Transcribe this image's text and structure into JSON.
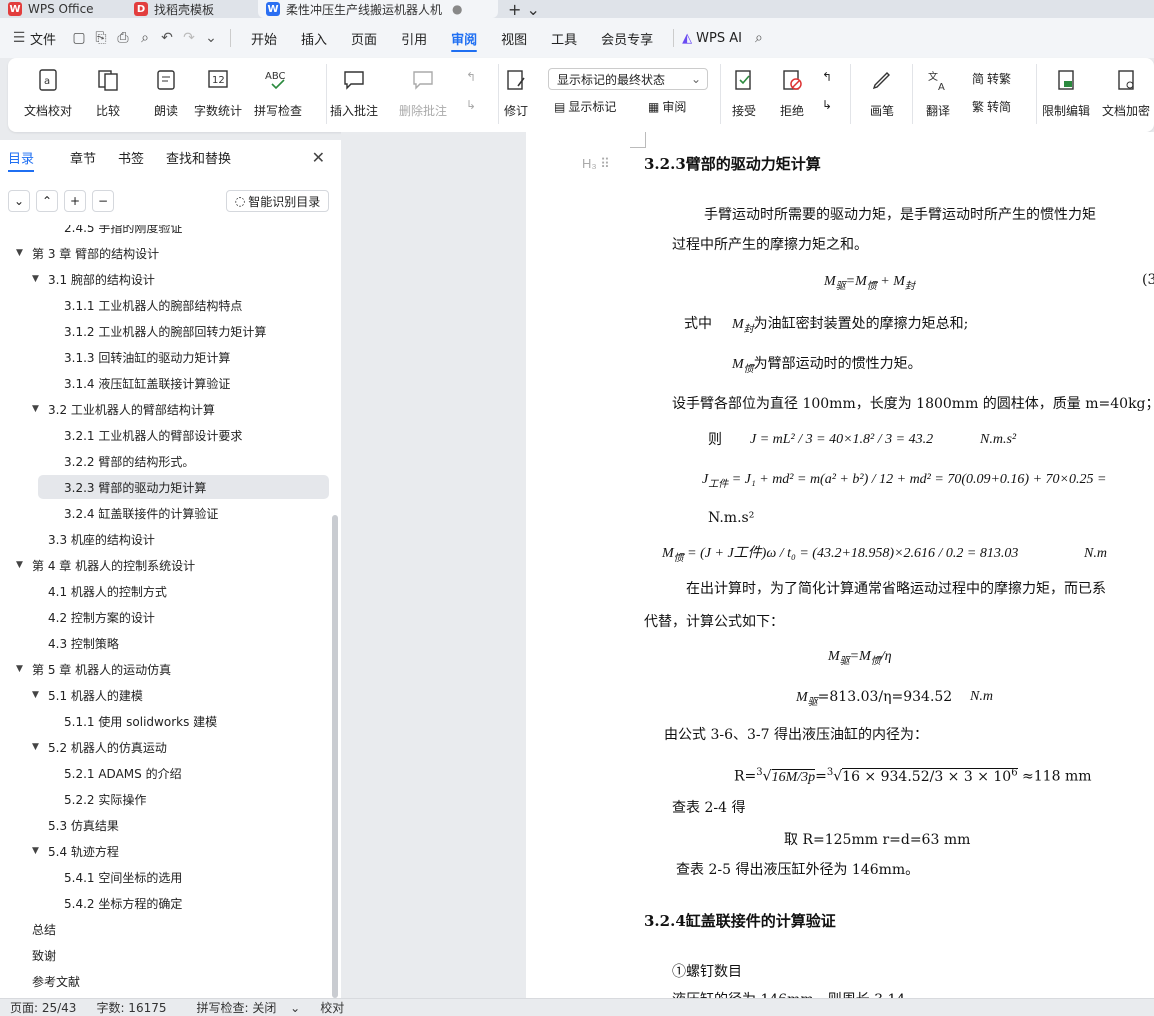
{
  "tabs": [
    {
      "label": "WPS Office"
    },
    {
      "label": "找稻壳模板"
    },
    {
      "label": "柔性冲压生产线搬运机器人机"
    }
  ],
  "menu": {
    "file": "文件",
    "items": [
      "开始",
      "插入",
      "页面",
      "引用",
      "审阅",
      "视图",
      "工具",
      "会员专享"
    ],
    "active": "审阅",
    "ai": "WPS AI"
  },
  "ribbon": {
    "buttons": [
      "文档校对",
      "比较",
      "朗读",
      "字数统计",
      "拼写检查",
      "插入批注",
      "删除批注",
      "修订",
      "显示标记",
      "审阅",
      "接受",
      "拒绝",
      "画笔",
      "翻译",
      "转简",
      "限制编辑",
      "文档加密",
      "转繁"
    ],
    "markup_select": "显示标记的最终状态"
  },
  "nav": {
    "tabs": [
      "目录",
      "章节",
      "书签",
      "查找和替换"
    ],
    "smart_toc": "智能识别目录",
    "toc": [
      {
        "text": "2.4.5 手指的刚度验证",
        "level": 2
      },
      {
        "text": "第 3 章  臂部的结构设计",
        "level": 0,
        "arrow": true
      },
      {
        "text": "3.1  腕部的结构设计",
        "level": 1,
        "arrow": true
      },
      {
        "text": "3.1.1 工业机器人的腕部结构特点",
        "level": 2
      },
      {
        "text": "3.1.2 工业机器人的腕部回转力矩计算",
        "level": 2
      },
      {
        "text": "3.1.3  回转油缸的驱动力矩计算",
        "level": 2
      },
      {
        "text": "3.1.4  液压缸缸盖联接计算验证",
        "level": 2
      },
      {
        "text": "3.2  工业机器人的臂部结构计算",
        "level": 1,
        "arrow": true
      },
      {
        "text": "3.2.1 工业机器人的臂部设计要求",
        "level": 2
      },
      {
        "text": "3.2.2 臂部的结构形式。",
        "level": 2
      },
      {
        "text": "3.2.3 臂部的驱动力矩计算",
        "level": 2,
        "selected": true
      },
      {
        "text": "3.2.4 缸盖联接件的计算验证",
        "level": 2
      },
      {
        "text": "3.3  机座的结构设计",
        "level": 1
      },
      {
        "text": "第 4 章   机器人的控制系统设计",
        "level": 0,
        "arrow": true
      },
      {
        "text": "4.1 机器人的控制方式",
        "level": 1
      },
      {
        "text": "4.2 控制方案的设计",
        "level": 1
      },
      {
        "text": "4.3 控制策略",
        "level": 1
      },
      {
        "text": "第 5 章     机器人的运动仿真",
        "level": 0,
        "arrow": true
      },
      {
        "text": "5.1 机器人的建模",
        "level": 1,
        "arrow": true
      },
      {
        "text": "5.1.1  使用 solidworks 建模",
        "level": 2
      },
      {
        "text": "5.2  机器人的仿真运动",
        "level": 1,
        "arrow": true
      },
      {
        "text": "5.2.1 ADAMS 的介绍",
        "level": 2
      },
      {
        "text": "5.2.2 实际操作",
        "level": 2
      },
      {
        "text": "5.3  仿真结果",
        "level": 1
      },
      {
        "text": "5.4  轨迹方程",
        "level": 1,
        "arrow": true
      },
      {
        "text": "5.4.1 空间坐标的选用",
        "level": 2
      },
      {
        "text": "5.4.2 坐标方程的确定",
        "level": 2
      },
      {
        "text": "总结",
        "level": 0
      },
      {
        "text": "致谢",
        "level": 0
      },
      {
        "text": "参考文献",
        "level": 0
      }
    ]
  },
  "doc": {
    "h1": "3.2.3臂部的驱动力矩计算",
    "p1a": "手臂运动时所需要的驱动力矩，是手臂运动时所产生的惯性力矩",
    "p1b": "过程中所产生的摩擦力矩之和。",
    "eq_num": "(3",
    "where1": "式中",
    "where1b": "为油缸密封装置处的摩擦力矩总和;",
    "where2": "为臂部运动时的惯性力矩。",
    "p2": "设手臂各部位为直径 100mm，长度为 1800mm 的圆柱体，质量 m=40kg；",
    "then": "则",
    "eq_j": "J = mL² / 3 = 40×1.8² / 3 = 43.2",
    "unit_nms2": "N.m.s²",
    "eq_jw": "= J₁ + md² = m(a² + b²) / 12 + md² = 70(0.09+0.16) + 70×0.25 =",
    "unit_nms2b": "N.m.s²",
    "eq_mg": "= (J + J工件)ω / t₀ = (43.2+18.958)×2.616 / 0.2 = 813.03",
    "unit_nm": "N.m",
    "p3a": "在出计算时，为了简化计算通常省略运动过程中的摩擦力矩，而已系",
    "p3b": "代替，计算公式如下：",
    "eq_q1": "/η",
    "eq_q2": "=813.03/η=934.52",
    "unit_nm2": "N.m",
    "p4": "由公式 3-6、3-7 得出液压油缸的内径为：",
    "eq_r": "≈118 mm",
    "p5": "查表 2-4 得",
    "p6": "取 R=125mm  r=d=63 mm",
    "p7": "查表 2-5 得出液压缸外径为 146mm。",
    "h2": "3.2.4缸盖联接件的计算验证",
    "p8": "①螺钉数目",
    "p9": "液压缸的径为 146mm，则周长 3.14"
  },
  "status": {
    "page": "页面: 25/43",
    "words": "字数: 16175",
    "spell": "拼写检查: 关闭",
    "proof": "校对"
  }
}
